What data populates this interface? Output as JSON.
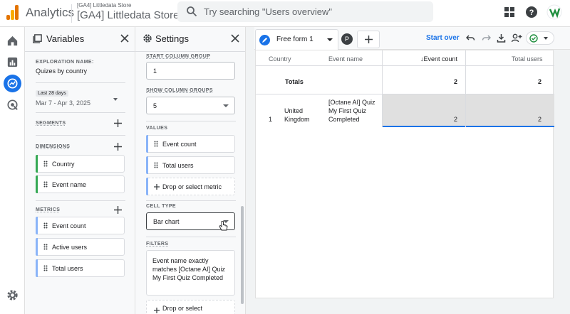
{
  "header": {
    "app_name": "Analytics",
    "account_small": "[GA4] Littledata Store",
    "account_big": "[GA4] Littledata Store",
    "search_placeholder": "Try searching \"Users overview\""
  },
  "variables": {
    "title": "Variables",
    "exploration_label": "EXPLORATION NAME:",
    "exploration_name": "Quizes by country",
    "date_label": "Last 28 days",
    "date_range": "Mar 7 - Apr 3, 2025",
    "segments_label": "SEGMENTS",
    "dimensions_label": "DIMENSIONS",
    "dimensions": [
      "Country",
      "Event name"
    ],
    "metrics_label": "METRICS",
    "metrics": [
      "Event count",
      "Active users",
      "Total users"
    ]
  },
  "settings": {
    "title": "Settings",
    "start_column_label": "START COLUMN GROUP",
    "start_column_value": "1",
    "show_column_label": "SHOW COLUMN GROUPS",
    "show_column_value": "5",
    "values_label": "VALUES",
    "values": [
      "Event count",
      "Total users"
    ],
    "drop_metric": "Drop or select metric",
    "cell_type_label": "CELL TYPE",
    "cell_type_value": "Bar chart",
    "filters_label": "FILTERS",
    "filter_text": "Event name exactly matches [Octane AI] Quiz My First Quiz Completed",
    "drop_select": "Drop or select"
  },
  "canvas": {
    "tab_name": "Free form 1",
    "avatar_letter": "P",
    "start_over": "Start over",
    "columns": [
      "Country",
      "Event name",
      "↓Event count",
      "Total users"
    ],
    "totals_label": "Totals",
    "totals": [
      "2",
      "2"
    ],
    "rows": [
      {
        "index": "1",
        "country": "United Kingdom",
        "event_name": "[Octane AI] Quiz My First Quiz Completed",
        "event_count": "2",
        "total_users": "2"
      }
    ]
  },
  "colors": {
    "accent": "#1a73e8",
    "dimension_bar": "#34a853",
    "metric_bar": "#8ab4f8"
  }
}
